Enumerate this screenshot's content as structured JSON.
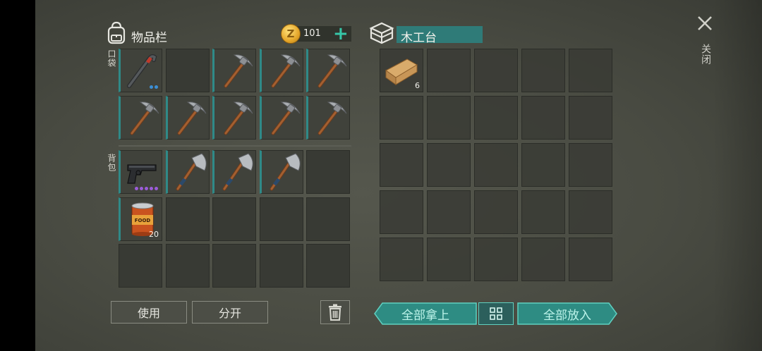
{
  "inventory": {
    "title": "物品栏",
    "coins": "101",
    "pocket_label": "口袋",
    "backpack_label": "背包",
    "pocket_slots": [
      {
        "item": "crowbar",
        "icon": "crowbar-icon",
        "count": "",
        "dots": 2,
        "dot_color": "#3c8fd6"
      },
      {
        "item": "",
        "icon": "",
        "count": "",
        "dots": 0,
        "dot_color": ""
      },
      {
        "item": "pickaxe",
        "icon": "pickaxe-icon",
        "count": "",
        "dots": 0,
        "dot_color": ""
      },
      {
        "item": "pickaxe",
        "icon": "pickaxe-icon",
        "count": "",
        "dots": 0,
        "dot_color": ""
      },
      {
        "item": "pickaxe",
        "icon": "pickaxe-icon",
        "count": "",
        "dots": 0,
        "dot_color": ""
      },
      {
        "item": "pickaxe",
        "icon": "pickaxe-icon",
        "count": "",
        "dots": 0,
        "dot_color": ""
      },
      {
        "item": "pickaxe",
        "icon": "pickaxe-icon",
        "count": "",
        "dots": 0,
        "dot_color": ""
      },
      {
        "item": "pickaxe",
        "icon": "pickaxe-icon",
        "count": "",
        "dots": 0,
        "dot_color": ""
      },
      {
        "item": "pickaxe",
        "icon": "pickaxe-icon",
        "count": "",
        "dots": 0,
        "dot_color": ""
      },
      {
        "item": "pickaxe",
        "icon": "pickaxe-icon",
        "count": "",
        "dots": 0,
        "dot_color": ""
      }
    ],
    "backpack_slots": [
      {
        "item": "pistol",
        "icon": "pistol-icon",
        "count": "",
        "dots": 5,
        "dot_color": "#9b5cd8"
      },
      {
        "item": "hatchet",
        "icon": "hatchet-icon",
        "count": "",
        "dots": 0,
        "dot_color": ""
      },
      {
        "item": "hatchet",
        "icon": "hatchet-icon",
        "count": "",
        "dots": 0,
        "dot_color": ""
      },
      {
        "item": "hatchet",
        "icon": "hatchet-icon",
        "count": "",
        "dots": 0,
        "dot_color": ""
      },
      {
        "item": "",
        "icon": "",
        "count": "",
        "dots": 0,
        "dot_color": ""
      },
      {
        "item": "canned food",
        "icon": "canned-food-icon",
        "count": "20",
        "dots": 0,
        "dot_color": ""
      },
      {
        "item": "",
        "icon": "",
        "count": "",
        "dots": 0,
        "dot_color": ""
      },
      {
        "item": "",
        "icon": "",
        "count": "",
        "dots": 0,
        "dot_color": ""
      },
      {
        "item": "",
        "icon": "",
        "count": "",
        "dots": 0,
        "dot_color": ""
      },
      {
        "item": "",
        "icon": "",
        "count": "",
        "dots": 0,
        "dot_color": ""
      },
      {
        "item": "",
        "icon": "",
        "count": "",
        "dots": 0,
        "dot_color": ""
      },
      {
        "item": "",
        "icon": "",
        "count": "",
        "dots": 0,
        "dot_color": ""
      },
      {
        "item": "",
        "icon": "",
        "count": "",
        "dots": 0,
        "dot_color": ""
      },
      {
        "item": "",
        "icon": "",
        "count": "",
        "dots": 0,
        "dot_color": ""
      },
      {
        "item": "",
        "icon": "",
        "count": "",
        "dots": 0,
        "dot_color": ""
      }
    ],
    "use_label": "使用",
    "split_label": "分开",
    "trash_icon": "trash-icon"
  },
  "station": {
    "title": "木工台",
    "icon": "crate-icon",
    "slots": [
      {
        "item": "wood plank",
        "icon": "plank-icon",
        "count": "6"
      }
    ],
    "take_all_label": "全部拿上",
    "sort_icon": "grid-sort-icon",
    "put_all_label": "全部放入"
  },
  "close_label": "关闭",
  "colors": {
    "accent": "#2f8a88",
    "button_teal": "#2e8c83",
    "coin": "#e5a62a"
  }
}
